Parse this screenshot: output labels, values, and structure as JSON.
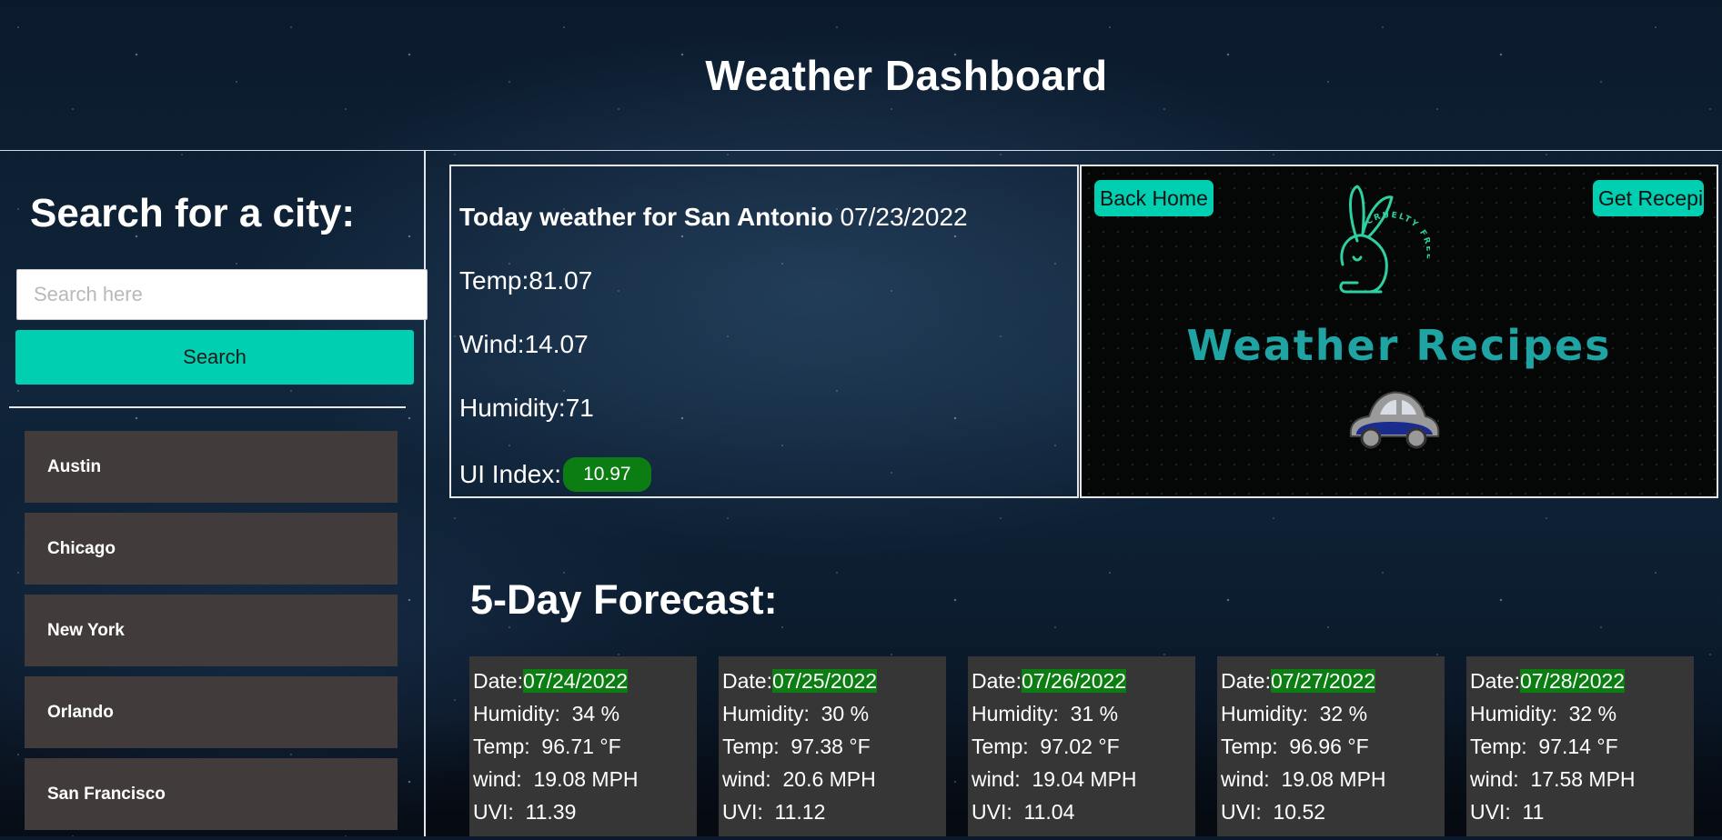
{
  "app_title": "Weather Dashboard",
  "sidebar": {
    "heading": "Search for a city:",
    "search_placeholder": "Search here",
    "search_button": "Search",
    "cities": [
      "Austin",
      "Chicago",
      "New York",
      "Orlando",
      "San Francisco"
    ]
  },
  "today": {
    "heading": "Today weather for San Antonio",
    "date": "07/23/2022",
    "temp_label": "Temp:",
    "temp": "81.07",
    "wind_label": "Wind:",
    "wind": "14.07",
    "humidity_label": "Humidity:",
    "humidity": "71",
    "uv_label": "UI Index:",
    "uv_value": "10.97"
  },
  "recipes_panel": {
    "back_home": "Back Home",
    "get_recipe": "Get Recepi",
    "brand_title": "Weather Recipes",
    "logo_badge_text": "CRUELTY FREE"
  },
  "forecast": {
    "title": "5-Day Forecast:",
    "labels": {
      "date": "Date:",
      "humidity": "Humidity:",
      "temp": "Temp:",
      "wind": "wind:",
      "uvi": "UVI:"
    },
    "days": [
      {
        "date": "07/24/2022",
        "humidity": "34 %",
        "temp": "96.71 °F",
        "wind": "19.08 MPH",
        "uvi": "11.39"
      },
      {
        "date": "07/25/2022",
        "humidity": "30 %",
        "temp": "97.38 °F",
        "wind": "20.6 MPH",
        "uvi": "11.12"
      },
      {
        "date": "07/26/2022",
        "humidity": "31 %",
        "temp": "97.02 °F",
        "wind": "19.04 MPH",
        "uvi": "11.04"
      },
      {
        "date": "07/27/2022",
        "humidity": "32 %",
        "temp": "96.96 °F",
        "wind": "19.08 MPH",
        "uvi": "10.52"
      },
      {
        "date": "07/28/2022",
        "humidity": "32 %",
        "temp": "97.14 °F",
        "wind": "17.58 MPH",
        "uvi": "11"
      }
    ]
  },
  "colors": {
    "accent": "#00cfb2",
    "uv_badge": "#0c7d12",
    "city_button": "#413b3b",
    "card_bg": "#363636",
    "brand_text": "#1fa3a3"
  }
}
